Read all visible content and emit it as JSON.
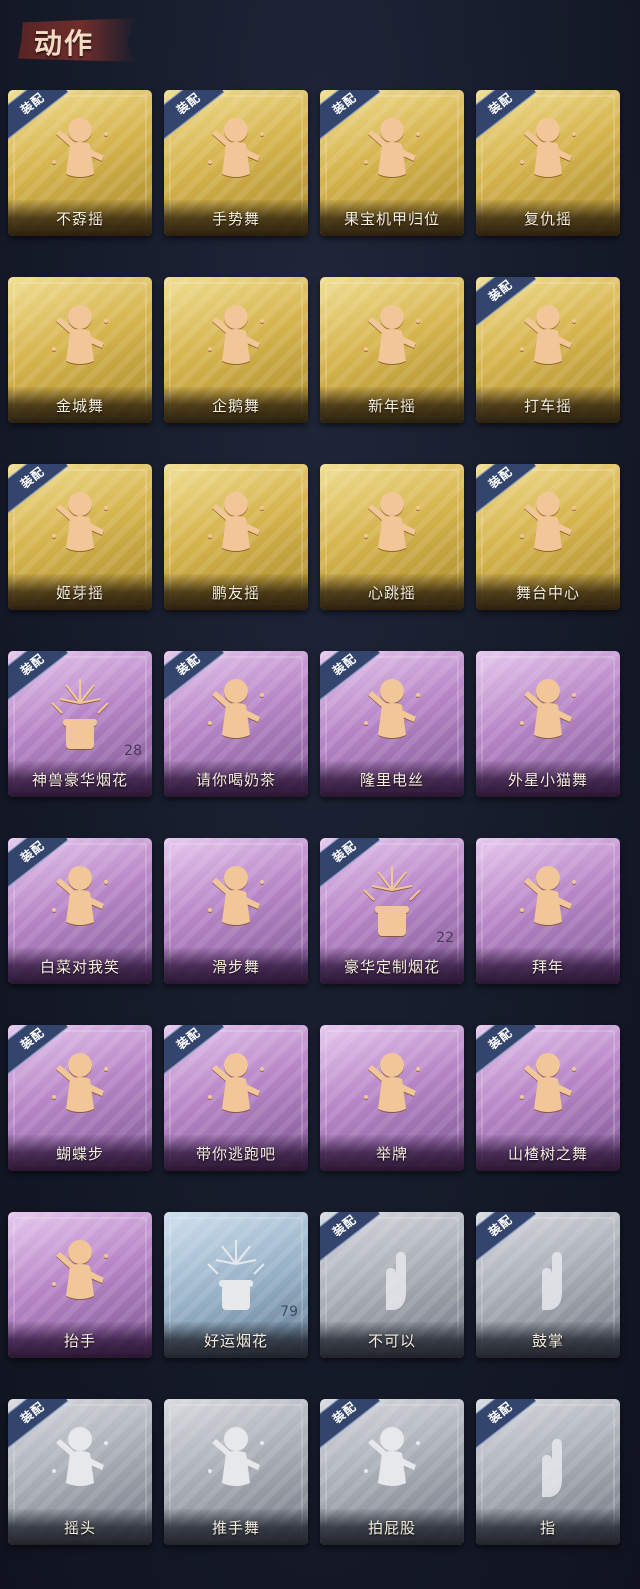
{
  "title": "动作",
  "equip_label": "装配",
  "colors": {
    "gold": "#d6b44e",
    "purple": "#b886c7",
    "blue": "#98b2c8",
    "gray": "#a6abb3",
    "figure_gold": "#f1c799",
    "figure_silver": "#e6e8ec"
  },
  "cards": [
    {
      "label": "不孬摇",
      "rarity": "gold",
      "equipped": true,
      "count": "",
      "icon": "dancer-icon"
    },
    {
      "label": "手势舞",
      "rarity": "gold",
      "equipped": true,
      "count": "",
      "icon": "dancer-icon"
    },
    {
      "label": "果宝机甲归位",
      "rarity": "gold",
      "equipped": true,
      "count": "",
      "icon": "dancer-icon"
    },
    {
      "label": "复仇摇",
      "rarity": "gold",
      "equipped": true,
      "count": "",
      "icon": "dancer-icon"
    },
    {
      "label": "金城舞",
      "rarity": "gold",
      "equipped": false,
      "count": "",
      "icon": "dancer-icon"
    },
    {
      "label": "企鹅舞",
      "rarity": "gold",
      "equipped": false,
      "count": "",
      "icon": "dancer-icon"
    },
    {
      "label": "新年摇",
      "rarity": "gold",
      "equipped": false,
      "count": "",
      "icon": "dancer-icon"
    },
    {
      "label": "打车摇",
      "rarity": "gold",
      "equipped": true,
      "count": "",
      "icon": "dancer-icon"
    },
    {
      "label": "姬芽摇",
      "rarity": "gold",
      "equipped": true,
      "count": "",
      "icon": "dancer-icon"
    },
    {
      "label": "鹏友摇",
      "rarity": "gold",
      "equipped": false,
      "count": "",
      "icon": "dancer-icon"
    },
    {
      "label": "心跳摇",
      "rarity": "gold",
      "equipped": false,
      "count": "",
      "icon": "dancer-icon"
    },
    {
      "label": "舞台中心",
      "rarity": "gold",
      "equipped": true,
      "count": "",
      "icon": "dancer-icon"
    },
    {
      "label": "神兽豪华烟花",
      "rarity": "purple",
      "equipped": true,
      "count": "28",
      "icon": "fireworks-icon"
    },
    {
      "label": "请你喝奶茶",
      "rarity": "purple",
      "equipped": true,
      "count": "",
      "icon": "dancer-icon"
    },
    {
      "label": "隆里电丝",
      "rarity": "purple",
      "equipped": true,
      "count": "",
      "icon": "dancer-icon"
    },
    {
      "label": "外星小猫舞",
      "rarity": "purple",
      "equipped": false,
      "count": "",
      "icon": "dancer-icon"
    },
    {
      "label": "白菜对我笑",
      "rarity": "purple",
      "equipped": true,
      "count": "",
      "icon": "dancer-icon"
    },
    {
      "label": "滑步舞",
      "rarity": "purple",
      "equipped": false,
      "count": "",
      "icon": "dancer-icon"
    },
    {
      "label": "豪华定制烟花",
      "rarity": "purple",
      "equipped": true,
      "count": "22",
      "icon": "fireworks-icon"
    },
    {
      "label": "拜年",
      "rarity": "purple",
      "equipped": false,
      "count": "",
      "icon": "dancer-icon"
    },
    {
      "label": "蝴蝶步",
      "rarity": "purple",
      "equipped": true,
      "count": "",
      "icon": "dancer-icon"
    },
    {
      "label": "带你逃跑吧",
      "rarity": "purple",
      "equipped": true,
      "count": "",
      "icon": "dancer-icon"
    },
    {
      "label": "举牌",
      "rarity": "purple",
      "equipped": false,
      "count": "",
      "icon": "dancer-icon"
    },
    {
      "label": "山楂树之舞",
      "rarity": "purple",
      "equipped": true,
      "count": "",
      "icon": "dancer-icon"
    },
    {
      "label": "抬手",
      "rarity": "purple",
      "equipped": false,
      "count": "",
      "icon": "dancer-icon"
    },
    {
      "label": "好运烟花",
      "rarity": "blue",
      "equipped": false,
      "count": "79",
      "icon": "fireworks-icon"
    },
    {
      "label": "不可以",
      "rarity": "gray",
      "equipped": true,
      "count": "",
      "icon": "hand-icon"
    },
    {
      "label": "鼓掌",
      "rarity": "gray",
      "equipped": true,
      "count": "",
      "icon": "hand-icon"
    },
    {
      "label": "摇头",
      "rarity": "gray",
      "equipped": true,
      "count": "",
      "icon": "dancer-icon"
    },
    {
      "label": "推手舞",
      "rarity": "gray",
      "equipped": false,
      "count": "",
      "icon": "dancer-icon"
    },
    {
      "label": "拍屁股",
      "rarity": "gray",
      "equipped": true,
      "count": "",
      "icon": "dancer-icon"
    },
    {
      "label": "指",
      "rarity": "gray",
      "equipped": true,
      "count": "",
      "icon": "hand-icon"
    }
  ]
}
